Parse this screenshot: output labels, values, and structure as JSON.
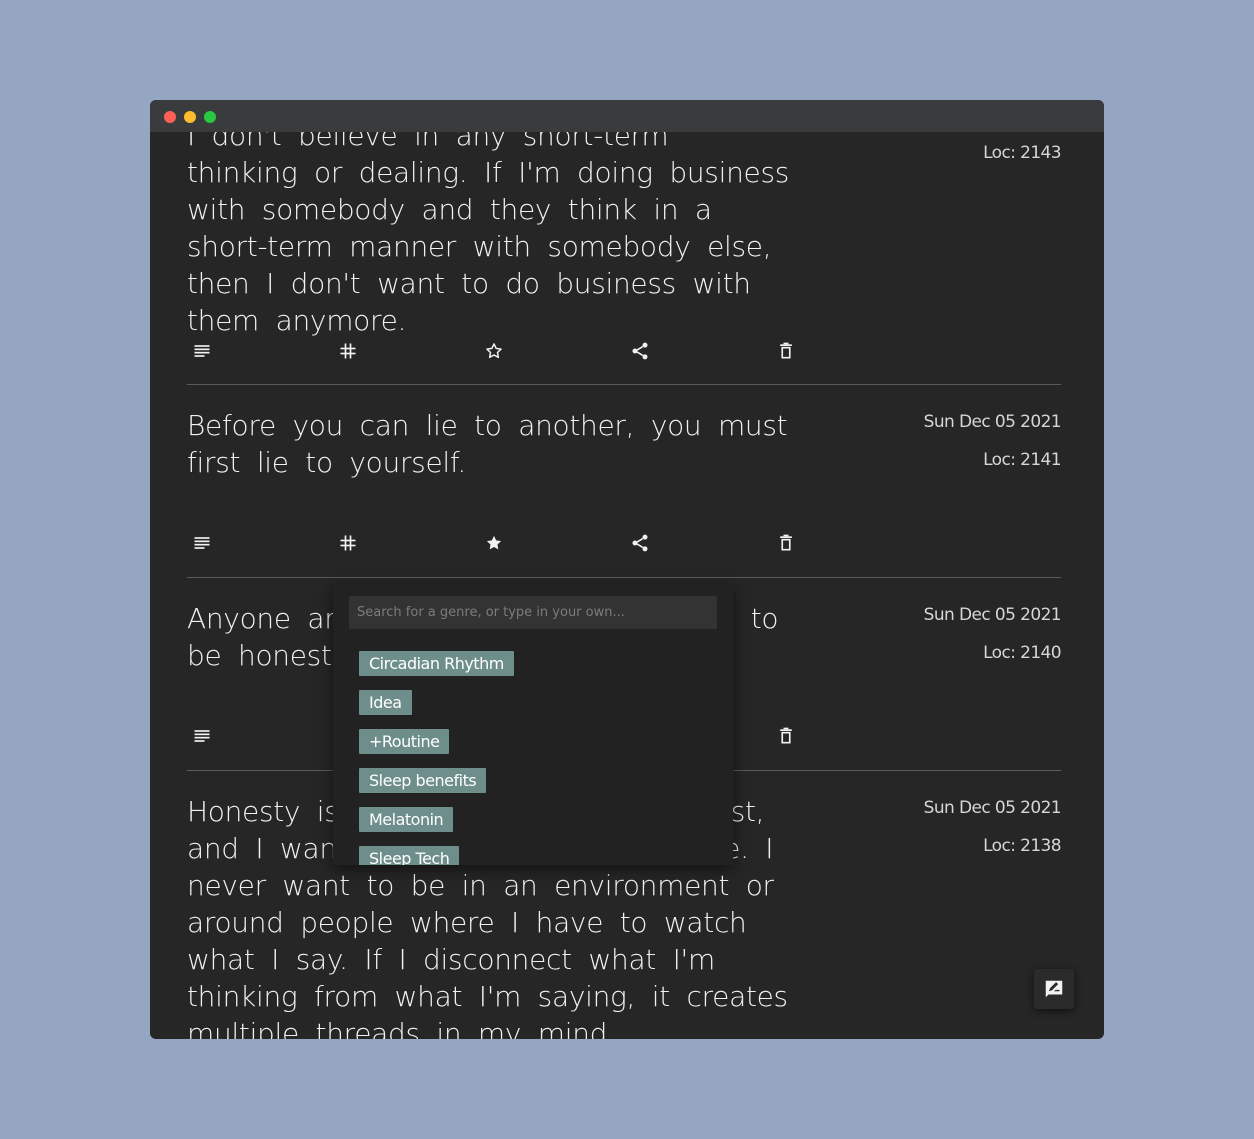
{
  "window": {
    "controls": [
      "close",
      "minimize",
      "maximize"
    ]
  },
  "cards": [
    {
      "text": "I don't believe in any short-term thinking or dealing. If I'm doing business with somebody and they think in a short-term manner with somebody else, then I don't want to do business with them anymore.",
      "date": "",
      "loc": "Loc: 2143",
      "starred": false
    },
    {
      "text": "Before you can lie to another, you must first lie to yourself.",
      "date": "Sun Dec 05 2021",
      "loc": "Loc: 2141",
      "starred": true
    },
    {
      "text": "Anyone around me who is not trying to be honest, I can't be around them.",
      "date": "Sun Dec 05 2021",
      "loc": "Loc: 2140",
      "starred": false
    },
    {
      "text": "Honesty is the one thing I value most, and I want to be able to just be me. I never want to be in an environment or around people where I have to watch what I say. If I disconnect what I'm thinking from what I'm saying, it creates multiple threads in my mind.",
      "date": "Sun Dec 05 2021",
      "loc": "Loc: 2138",
      "starred": false
    }
  ],
  "icons": {
    "notes": "notes-icon",
    "tag": "hashtag-icon",
    "star": "star-icon",
    "share": "share-icon",
    "delete": "trash-icon",
    "compose": "compose-icon"
  },
  "genre_dropdown": {
    "placeholder": "Search for a genre, or type in your own...",
    "tags": [
      "Circadian Rhythm",
      "Idea",
      "+Routine",
      "Sleep benefits",
      "Melatonin",
      "Sleep Tech"
    ]
  },
  "colors": {
    "background": "#94a6c2",
    "panel": "#262626",
    "tag": "#6e8e8b"
  }
}
